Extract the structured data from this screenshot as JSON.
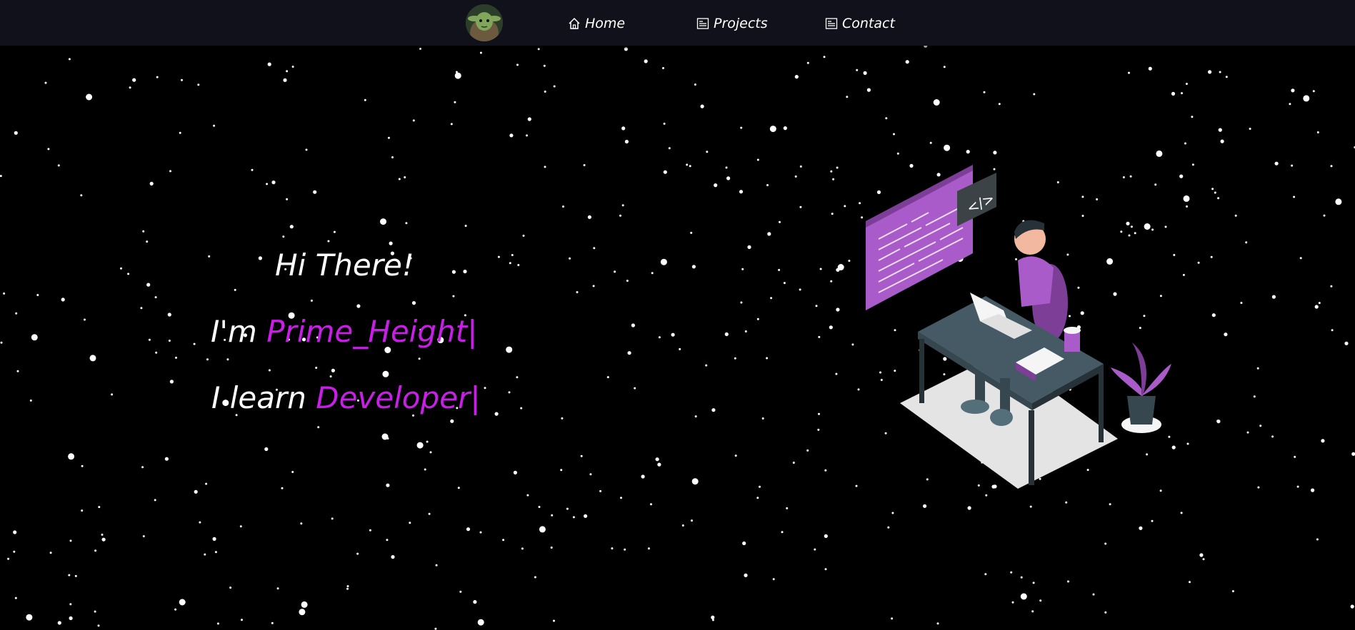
{
  "nav": {
    "avatar_alt": "profile avatar",
    "items": [
      {
        "label": "Home",
        "icon": "home-icon"
      },
      {
        "label": "Projects",
        "icon": "projects-icon"
      },
      {
        "label": "Contact",
        "icon": "contact-icon"
      }
    ]
  },
  "hero": {
    "greeting": "Hi There!",
    "intro_prefix": "I'm",
    "name": "Prime_Height|",
    "role_prefix": "I learn",
    "role": "Developer|"
  },
  "colors": {
    "accent": "#c81ee8",
    "navbar": "#11111c",
    "background": "#000000",
    "illustration_purple": "#a85bc9"
  }
}
